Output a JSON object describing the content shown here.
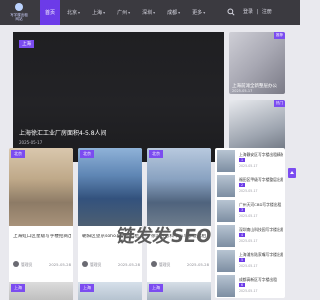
{
  "brand": {
    "name_line1": "写字楼出租",
    "name_line2": "网站"
  },
  "nav": {
    "items": [
      {
        "label": "首页",
        "active": true
      },
      {
        "label": "北京",
        "caret": true
      },
      {
        "label": "上海",
        "caret": true
      },
      {
        "label": "广州",
        "caret": true
      },
      {
        "label": "深圳",
        "caret": true
      },
      {
        "label": "成都",
        "caret": true
      },
      {
        "label": "更多",
        "caret": true
      }
    ]
  },
  "auth": {
    "login": "登录",
    "register": "注册"
  },
  "hero": {
    "tag": "上海",
    "title": "上海徐汇工业厂房面积4-5.8人间",
    "date": "2025-05-17",
    "dots": 3
  },
  "side_cards": [
    {
      "title": "上海前滩全新整层办公",
      "date": "2025-05-17",
      "badge": "推荐"
    },
    {
      "title": "",
      "date": "2025-05-17",
      "badge": "热门"
    }
  ],
  "cards": [
    {
      "tag": "北京",
      "title": "上海虹口区星级写字楼招商出租",
      "author": "管理员",
      "date": "2025-05-28"
    },
    {
      "tag": "北京",
      "title": "朝阳区望京soho写字楼出租",
      "author": "管理员",
      "date": "2025-05-28"
    },
    {
      "tag": "北京",
      "title": "徐汇区万科中心写字楼出租",
      "author": "管理员",
      "date": "2025-05-28"
    }
  ],
  "row2_tags": [
    "上海",
    "上海",
    "上海"
  ],
  "list": [
    {
      "title": "上海静安区写字楼出租精装修",
      "date": "2025-05-17",
      "badge": "1"
    },
    {
      "title": "福田区甲级写字楼整层出租",
      "date": "2025-05-17",
      "badge": "2"
    },
    {
      "title": "广州天河CBD写字楼出租",
      "date": "2025-05-17",
      "badge": "3"
    },
    {
      "title": "深圳南山科技园写字楼出租",
      "date": "2025-05-17",
      "badge": "4"
    },
    {
      "title": "上海浦东陆家嘴写字楼出租",
      "date": "2025-05-17",
      "badge": "5"
    },
    {
      "title": "成都高新区写字楼出租",
      "date": "2025-05-17",
      "badge": "6"
    }
  ],
  "watermark": "链发发SEO",
  "colors": {
    "topbar": "#3b3a40",
    "accent": "#6c3be8",
    "page_bg": "#e9e9ee"
  }
}
